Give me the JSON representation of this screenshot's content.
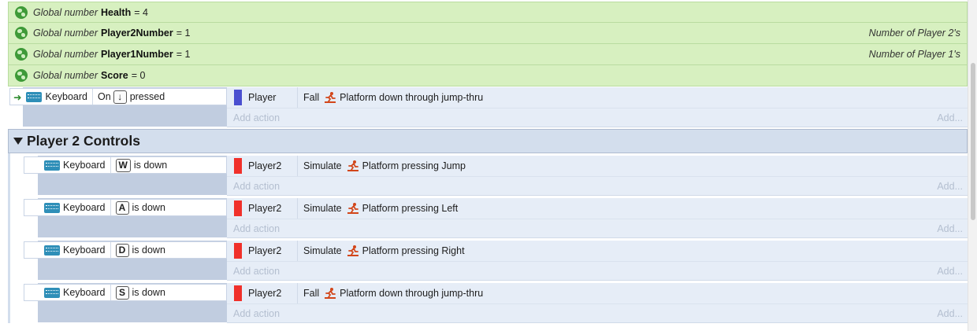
{
  "globals": [
    {
      "kind": "Global number",
      "name": "Health",
      "value": "= 4",
      "comment": ""
    },
    {
      "kind": "Global number",
      "name": "Player2Number",
      "value": "= 1",
      "comment": "Number of Player 2's"
    },
    {
      "kind": "Global number",
      "name": "Player1Number",
      "value": "= 1",
      "comment": "Number of Player 1's"
    },
    {
      "kind": "Global number",
      "name": "Score",
      "value": "= 0",
      "comment": ""
    }
  ],
  "top_event": {
    "object": "Keyboard",
    "on_label": "On",
    "key": "↓",
    "trigger": "pressed",
    "action_object": "Player",
    "action_color": "#4a4fd0",
    "action_verb": "Fall",
    "action_text": "Platform down through jump-thru",
    "add_action": "Add action",
    "add_more": "Add..."
  },
  "group": {
    "title": "Player 2 Controls",
    "events": [
      {
        "object": "Keyboard",
        "key": "W",
        "trigger": "is down",
        "action_object": "Player2",
        "action_color": "#f0302a",
        "action_verb": "Simulate",
        "action_text": "Platform pressing Jump",
        "add_action": "Add action",
        "add_more": "Add..."
      },
      {
        "object": "Keyboard",
        "key": "A",
        "trigger": "is down",
        "action_object": "Player2",
        "action_color": "#f0302a",
        "action_verb": "Simulate",
        "action_text": "Platform pressing Left",
        "add_action": "Add action",
        "add_more": "Add..."
      },
      {
        "object": "Keyboard",
        "key": "D",
        "trigger": "is down",
        "action_object": "Player2",
        "action_color": "#f0302a",
        "action_verb": "Simulate",
        "action_text": "Platform pressing Right",
        "add_action": "Add action",
        "add_more": "Add..."
      },
      {
        "object": "Keyboard",
        "key": "S",
        "trigger": "is down",
        "action_object": "Player2",
        "action_color": "#f0302a",
        "action_verb": "Fall",
        "action_text": "Platform down through jump-thru",
        "add_action": "Add action",
        "add_more": "Add..."
      }
    ]
  },
  "icons": {
    "global": "globe-icon",
    "keyboard": "keyboard-icon",
    "behavior": "platform-behavior-icon",
    "trigger": "trigger-arrow-icon",
    "group_toggle": "collapse-triangle-icon"
  }
}
